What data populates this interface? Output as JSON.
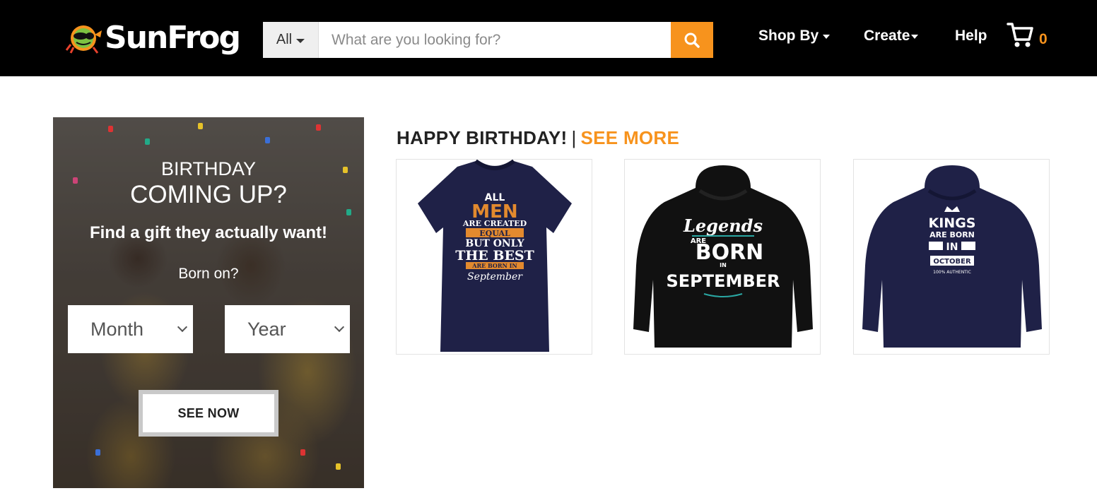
{
  "header": {
    "brand": "SunFrog",
    "search": {
      "category": "All",
      "placeholder": "What are you looking for?",
      "value": ""
    },
    "nav": [
      {
        "label": "Shop By",
        "has_dropdown": true
      },
      {
        "label": "Create",
        "has_dropdown": true
      },
      {
        "label": "Help",
        "has_dropdown": false
      }
    ],
    "cart_count": "0"
  },
  "promo": {
    "line1": "BIRTHDAY",
    "line2": "COMING UP?",
    "line3": "Find a gift they actually want!",
    "born_label": "Born on?",
    "month_select": "Month",
    "year_select": "Year",
    "cta": "SEE NOW"
  },
  "section": {
    "title": "HAPPY BIRTHDAY!",
    "separator": "|",
    "see_more": "SEE MORE"
  },
  "products": [
    {
      "type": "t-shirt",
      "color": "#1f2147",
      "print_text": [
        "ALL",
        "MEN",
        "ARE CREATED",
        "EQUAL",
        "BUT ONLY",
        "THE BEST",
        "ARE BORN IN",
        "September"
      ]
    },
    {
      "type": "hoodie",
      "color": "#111111",
      "print_text": [
        "Legends",
        "ARE",
        "BORN",
        "IN",
        "SEPTEMBER"
      ]
    },
    {
      "type": "hoodie",
      "color": "#1f2147",
      "print_text": [
        "KINGS",
        "ARE BORN",
        "IN",
        "OCTOBER",
        "100% AUTHENTIC"
      ]
    }
  ],
  "colors": {
    "accent": "#f7931d",
    "header_bg": "#000000"
  }
}
